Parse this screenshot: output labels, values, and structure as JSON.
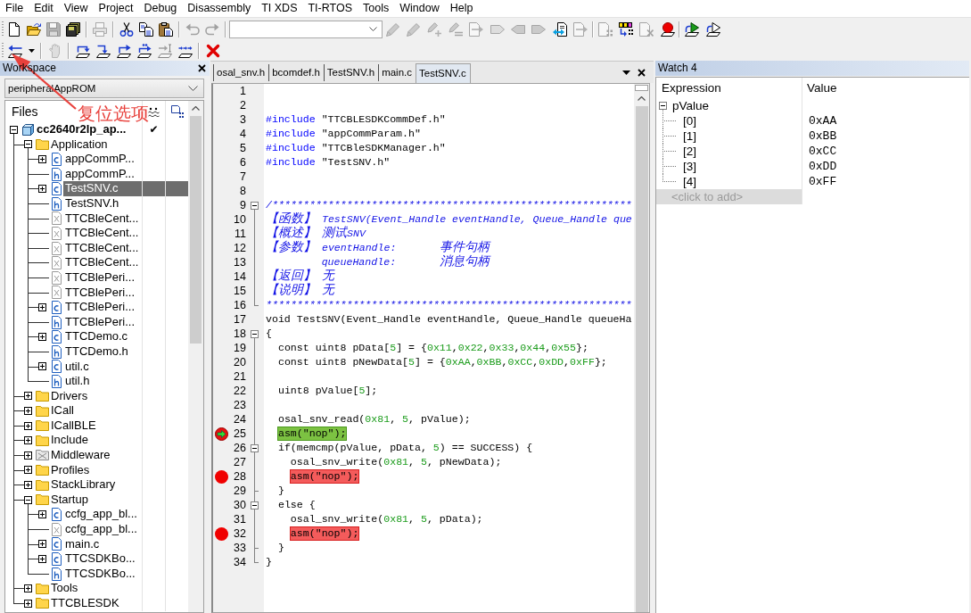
{
  "menu_bar": [
    "File",
    "Edit",
    "View",
    "Project",
    "Debug",
    "Disassembly",
    "TI XDS",
    "TI-RTOS",
    "Tools",
    "Window",
    "Help"
  ],
  "toolbar_1": [
    {
      "kind": "new-file",
      "disabled": false
    },
    {
      "kind": "open-folder",
      "disabled": false
    },
    {
      "kind": "save",
      "disabled": true
    },
    {
      "kind": "save-all",
      "disabled": false
    },
    {
      "kind": "separator"
    },
    {
      "kind": "print",
      "disabled": true
    },
    {
      "kind": "separator"
    },
    {
      "kind": "cut",
      "disabled": false
    },
    {
      "kind": "copy",
      "disabled": false
    },
    {
      "kind": "paste",
      "disabled": false
    },
    {
      "kind": "separator"
    },
    {
      "kind": "undo",
      "disabled": true
    },
    {
      "kind": "redo",
      "disabled": true
    },
    {
      "kind": "separator"
    },
    {
      "kind": "combo"
    },
    {
      "kind": "pen",
      "disabled": true
    },
    {
      "kind": "pen",
      "disabled": true
    },
    {
      "kind": "pen-plus",
      "disabled": true
    },
    {
      "kind": "pen-lines",
      "disabled": true
    },
    {
      "kind": "doc-arrow",
      "disabled": true
    },
    {
      "kind": "tag",
      "disabled": true
    },
    {
      "kind": "tag-left",
      "disabled": true
    },
    {
      "kind": "tag-right",
      "disabled": true
    },
    {
      "kind": "doc-swap",
      "disabled": false
    },
    {
      "kind": "doc-arrow",
      "disabled": true
    },
    {
      "kind": "separator"
    },
    {
      "kind": "doc-grid",
      "disabled": true
    },
    {
      "kind": "blocks",
      "disabled": false
    },
    {
      "kind": "doc-cross",
      "disabled": true
    },
    {
      "kind": "breakpoint",
      "disabled": false
    },
    {
      "kind": "separator"
    },
    {
      "kind": "play",
      "disabled": false
    },
    {
      "kind": "play-outline",
      "disabled": false
    }
  ],
  "toolbar_2": [
    {
      "kind": "reset",
      "disabled": false
    },
    {
      "kind": "dropdown",
      "disabled": false
    },
    {
      "kind": "separator"
    },
    {
      "kind": "break",
      "disabled": true
    },
    {
      "kind": "separator"
    },
    {
      "kind": "step-over",
      "disabled": false
    },
    {
      "kind": "step-into",
      "disabled": false
    },
    {
      "kind": "step-out",
      "disabled": false
    },
    {
      "kind": "next-statement",
      "disabled": false
    },
    {
      "kind": "run-to-cursor",
      "disabled": true
    },
    {
      "kind": "autostep",
      "disabled": false
    },
    {
      "kind": "separator"
    },
    {
      "kind": "stop",
      "disabled": false
    }
  ],
  "workspace": {
    "title": "Workspace",
    "configuration": "peripheralAppROM",
    "column_header": "Files",
    "tree": [
      {
        "label": "cc2640r2lp_ap...",
        "kind": "project",
        "expanded": true,
        "selected": false,
        "column_2": "✔",
        "children": [
          {
            "label": "Application",
            "kind": "folder",
            "expanded": true,
            "selected": false,
            "children": [
              {
                "label": "appCommP...",
                "kind": "c-file",
                "expanded": false,
                "selected": false
              },
              {
                "label": "appCommP...",
                "kind": "h-file",
                "selected": false
              },
              {
                "label": "TestSNV.c",
                "kind": "c-file",
                "expanded": false,
                "selected": true
              },
              {
                "label": "TestSNV.h",
                "kind": "h-file",
                "selected": false
              },
              {
                "label": "TTCBleCent...",
                "kind": "excluded-file",
                "selected": false
              },
              {
                "label": "TTCBleCent...",
                "kind": "excluded-file",
                "selected": false
              },
              {
                "label": "TTCBleCent...",
                "kind": "excluded-file",
                "selected": false
              },
              {
                "label": "TTCBleCent...",
                "kind": "excluded-file",
                "selected": false
              },
              {
                "label": "TTCBlePeri...",
                "kind": "excluded-file",
                "selected": false
              },
              {
                "label": "TTCBlePeri...",
                "kind": "excluded-file",
                "selected": false
              },
              {
                "label": "TTCBlePeri...",
                "kind": "c-file",
                "expanded": false,
                "selected": false
              },
              {
                "label": "TTCBlePeri...",
                "kind": "h-file",
                "selected": false
              },
              {
                "label": "TTCDemo.c",
                "kind": "c-file",
                "expanded": false,
                "selected": false
              },
              {
                "label": "TTCDemo.h",
                "kind": "h-file",
                "selected": false
              },
              {
                "label": "util.c",
                "kind": "c-file",
                "expanded": false,
                "selected": false
              },
              {
                "label": "util.h",
                "kind": "h-file",
                "selected": false
              }
            ]
          },
          {
            "label": "Drivers",
            "kind": "folder",
            "expanded": false,
            "selected": false
          },
          {
            "label": "ICall",
            "kind": "folder",
            "expanded": false,
            "selected": false
          },
          {
            "label": "ICallBLE",
            "kind": "folder",
            "expanded": false,
            "selected": false
          },
          {
            "label": "Include",
            "kind": "folder",
            "expanded": false,
            "selected": false
          },
          {
            "label": "Middleware",
            "kind": "excluded-folder",
            "expanded": false,
            "selected": false
          },
          {
            "label": "Profiles",
            "kind": "folder",
            "expanded": false,
            "selected": false
          },
          {
            "label": "StackLibrary",
            "kind": "folder",
            "expanded": false,
            "selected": false
          },
          {
            "label": "Startup",
            "kind": "folder",
            "expanded": true,
            "selected": false,
            "children": [
              {
                "label": "ccfg_app_bl...",
                "kind": "c-file",
                "expanded": false,
                "selected": false
              },
              {
                "label": "ccfg_app_bl...",
                "kind": "excluded-file",
                "selected": false
              },
              {
                "label": "main.c",
                "kind": "c-file",
                "expanded": false,
                "selected": false
              },
              {
                "label": "TTCSDKBo...",
                "kind": "c-file",
                "expanded": false,
                "selected": false
              },
              {
                "label": "TTCSDKBo...",
                "kind": "h-file",
                "selected": false
              }
            ]
          },
          {
            "label": "Tools",
            "kind": "folder",
            "expanded": false,
            "selected": false
          },
          {
            "label": "TTCBLESDK",
            "kind": "folder",
            "expanded": false,
            "selected": false
          }
        ]
      }
    ]
  },
  "editor": {
    "tabs": [
      {
        "label": "osal_snv.h",
        "selected": false
      },
      {
        "label": "bcomdef.h",
        "selected": false
      },
      {
        "label": "TestSNV.h",
        "selected": false
      },
      {
        "label": "main.c",
        "selected": false
      },
      {
        "label": "TestSNV.c",
        "selected": true
      }
    ],
    "lines": [
      {
        "number": "1",
        "kind": "plain",
        "breakpoint": false,
        "current": false
      },
      {
        "number": "2",
        "kind": "plain",
        "breakpoint": false,
        "current": false
      },
      {
        "number": "3",
        "kind": "plain",
        "breakpoint": false,
        "current": false,
        "segments": [
          {
            "kind": "directive",
            "text": "#include"
          },
          {
            "kind": "plain",
            "text": " \"TTCBLESDKCommDef.h\""
          }
        ]
      },
      {
        "number": "4",
        "kind": "plain",
        "breakpoint": false,
        "current": false,
        "segments": [
          {
            "kind": "directive",
            "text": "#include"
          },
          {
            "kind": "plain",
            "text": " \"appCommParam.h\""
          }
        ]
      },
      {
        "number": "5",
        "kind": "plain",
        "breakpoint": false,
        "current": false,
        "segments": [
          {
            "kind": "directive",
            "text": "#include"
          },
          {
            "kind": "plain",
            "text": " \"TTCBleSDKManager.h\""
          }
        ]
      },
      {
        "number": "6",
        "kind": "plain",
        "breakpoint": false,
        "current": false,
        "segments": [
          {
            "kind": "directive",
            "text": "#include"
          },
          {
            "kind": "plain",
            "text": " \"TestSNV.h\""
          }
        ]
      },
      {
        "number": "7",
        "kind": "plain",
        "breakpoint": false,
        "current": false
      },
      {
        "number": "8",
        "kind": "plain",
        "breakpoint": false,
        "current": false
      },
      {
        "number": "9",
        "kind": "start",
        "breakpoint": false,
        "current": false,
        "segments": [
          {
            "kind": "comment",
            "text": "/**********************************************************"
          }
        ]
      },
      {
        "number": "10",
        "kind": "line",
        "breakpoint": false,
        "current": false,
        "segments": [
          {
            "kind": "comment",
            "text": "【函数】 TestSNV(Event_Handle eventHandle, Queue_Handle que"
          }
        ]
      },
      {
        "number": "11",
        "kind": "line",
        "breakpoint": false,
        "current": false,
        "segments": [
          {
            "kind": "comment",
            "text": "【概述】 测试SNV"
          }
        ]
      },
      {
        "number": "12",
        "kind": "line",
        "breakpoint": false,
        "current": false,
        "segments": [
          {
            "kind": "comment",
            "text": "【参数】 eventHandle:       事件句柄"
          }
        ]
      },
      {
        "number": "13",
        "kind": "line",
        "breakpoint": false,
        "current": false,
        "segments": [
          {
            "kind": "comment",
            "text": "         queueHandle:       消息句柄"
          }
        ]
      },
      {
        "number": "14",
        "kind": "line",
        "breakpoint": false,
        "current": false,
        "segments": [
          {
            "kind": "comment",
            "text": "【返回】 无"
          }
        ]
      },
      {
        "number": "15",
        "kind": "line",
        "breakpoint": false,
        "current": false,
        "segments": [
          {
            "kind": "comment",
            "text": "【说明】 无"
          }
        ]
      },
      {
        "number": "16",
        "kind": "end",
        "breakpoint": false,
        "current": false,
        "segments": [
          {
            "kind": "comment",
            "text": "***********************************************************"
          }
        ]
      },
      {
        "number": "17",
        "kind": "plain",
        "breakpoint": false,
        "current": false,
        "segments": [
          {
            "kind": "plain",
            "text": "void TestSNV(Event_Handle eventHandle, Queue_Handle queueHa"
          }
        ]
      },
      {
        "number": "18",
        "kind": "start",
        "breakpoint": false,
        "current": false,
        "segments": [
          {
            "kind": "plain",
            "text": "{"
          }
        ]
      },
      {
        "number": "19",
        "kind": "line",
        "breakpoint": false,
        "current": false,
        "segments": [
          {
            "kind": "plain",
            "text": "  const uint8 pData["
          },
          {
            "kind": "number",
            "text": "5"
          },
          {
            "kind": "plain",
            "text": "] = {"
          },
          {
            "kind": "number",
            "text": "0x11"
          },
          {
            "kind": "plain",
            "text": ","
          },
          {
            "kind": "number",
            "text": "0x22"
          },
          {
            "kind": "plain",
            "text": ","
          },
          {
            "kind": "number",
            "text": "0x33"
          },
          {
            "kind": "plain",
            "text": ","
          },
          {
            "kind": "number",
            "text": "0x44"
          },
          {
            "kind": "plain",
            "text": ","
          },
          {
            "kind": "number",
            "text": "0x55"
          },
          {
            "kind": "plain",
            "text": "};"
          }
        ]
      },
      {
        "number": "20",
        "kind": "line",
        "breakpoint": false,
        "current": false,
        "segments": [
          {
            "kind": "plain",
            "text": "  const uint8 pNewData["
          },
          {
            "kind": "number",
            "text": "5"
          },
          {
            "kind": "plain",
            "text": "] = {"
          },
          {
            "kind": "number",
            "text": "0xAA"
          },
          {
            "kind": "plain",
            "text": ","
          },
          {
            "kind": "number",
            "text": "0xBB"
          },
          {
            "kind": "plain",
            "text": ","
          },
          {
            "kind": "number",
            "text": "0xCC"
          },
          {
            "kind": "plain",
            "text": ","
          },
          {
            "kind": "number",
            "text": "0xDD"
          },
          {
            "kind": "plain",
            "text": ","
          },
          {
            "kind": "number",
            "text": "0xFF"
          },
          {
            "kind": "plain",
            "text": "};"
          }
        ]
      },
      {
        "number": "21",
        "kind": "line",
        "breakpoint": false,
        "current": false
      },
      {
        "number": "22",
        "kind": "line",
        "breakpoint": false,
        "current": false,
        "segments": [
          {
            "kind": "plain",
            "text": "  uint8 pValue["
          },
          {
            "kind": "number",
            "text": "5"
          },
          {
            "kind": "plain",
            "text": "];"
          }
        ]
      },
      {
        "number": "23",
        "kind": "line",
        "breakpoint": false,
        "current": false
      },
      {
        "number": "24",
        "kind": "line",
        "breakpoint": false,
        "current": false,
        "segments": [
          {
            "kind": "plain",
            "text": "  osal_snv_read("
          },
          {
            "kind": "number",
            "text": "0x81"
          },
          {
            "kind": "plain",
            "text": ", "
          },
          {
            "kind": "number",
            "text": "5"
          },
          {
            "kind": "plain",
            "text": ", pValue);"
          }
        ]
      },
      {
        "number": "25",
        "kind": "line",
        "breakpoint": true,
        "current": true,
        "segments": [
          {
            "kind": "plain",
            "text": "  asm(\"nop\");"
          }
        ]
      },
      {
        "number": "26",
        "kind": "nested-start",
        "breakpoint": false,
        "current": false,
        "segments": [
          {
            "kind": "plain",
            "text": "  if(memcmp(pValue, pData, "
          },
          {
            "kind": "number",
            "text": "5"
          },
          {
            "kind": "plain",
            "text": ") == SUCCESS) {"
          }
        ]
      },
      {
        "number": "27",
        "kind": "line",
        "breakpoint": false,
        "current": false,
        "segments": [
          {
            "kind": "plain",
            "text": "    osal_snv_write("
          },
          {
            "kind": "number",
            "text": "0x81"
          },
          {
            "kind": "plain",
            "text": ", "
          },
          {
            "kind": "number",
            "text": "5"
          },
          {
            "kind": "plain",
            "text": ", pNewData);"
          }
        ]
      },
      {
        "number": "28",
        "kind": "line",
        "breakpoint": true,
        "current": false,
        "segments": [
          {
            "kind": "plain",
            "text": "    asm(\"nop\");"
          }
        ]
      },
      {
        "number": "29",
        "kind": "tick",
        "breakpoint": false,
        "current": false,
        "segments": [
          {
            "kind": "plain",
            "text": "  }"
          }
        ]
      },
      {
        "number": "30",
        "kind": "nested-start",
        "breakpoint": false,
        "current": false,
        "segments": [
          {
            "kind": "plain",
            "text": "  else {"
          }
        ]
      },
      {
        "number": "31",
        "kind": "line",
        "breakpoint": false,
        "current": false,
        "segments": [
          {
            "kind": "plain",
            "text": "    osal_snv_write("
          },
          {
            "kind": "number",
            "text": "0x81"
          },
          {
            "kind": "plain",
            "text": ", "
          },
          {
            "kind": "number",
            "text": "5"
          },
          {
            "kind": "plain",
            "text": ", pData);"
          }
        ]
      },
      {
        "number": "32",
        "kind": "line",
        "breakpoint": true,
        "current": false,
        "segments": [
          {
            "kind": "plain",
            "text": "    asm(\"nop\");"
          }
        ]
      },
      {
        "number": "33",
        "kind": "tick",
        "breakpoint": false,
        "current": false,
        "segments": [
          {
            "kind": "plain",
            "text": "  }"
          }
        ]
      },
      {
        "number": "34",
        "kind": "end",
        "breakpoint": false,
        "current": false,
        "segments": [
          {
            "kind": "plain",
            "text": "}"
          }
        ]
      }
    ]
  },
  "watch": {
    "title": "Watch 4",
    "columns": [
      "Expression",
      "Value"
    ],
    "rows": [
      {
        "expression": "pValue",
        "expanded": true,
        "children": [
          {
            "expression": "[0]",
            "value": "0xAA"
          },
          {
            "expression": "[1]",
            "value": "0xBB"
          },
          {
            "expression": "[2]",
            "value": "0xCC"
          },
          {
            "expression": "[3]",
            "value": "0xDD"
          },
          {
            "expression": "[4]",
            "value": "0xFF"
          }
        ]
      }
    ],
    "new_entry": {
      "placeholder": "<click to add>"
    }
  },
  "annotation": {
    "text": "复位选项"
  }
}
